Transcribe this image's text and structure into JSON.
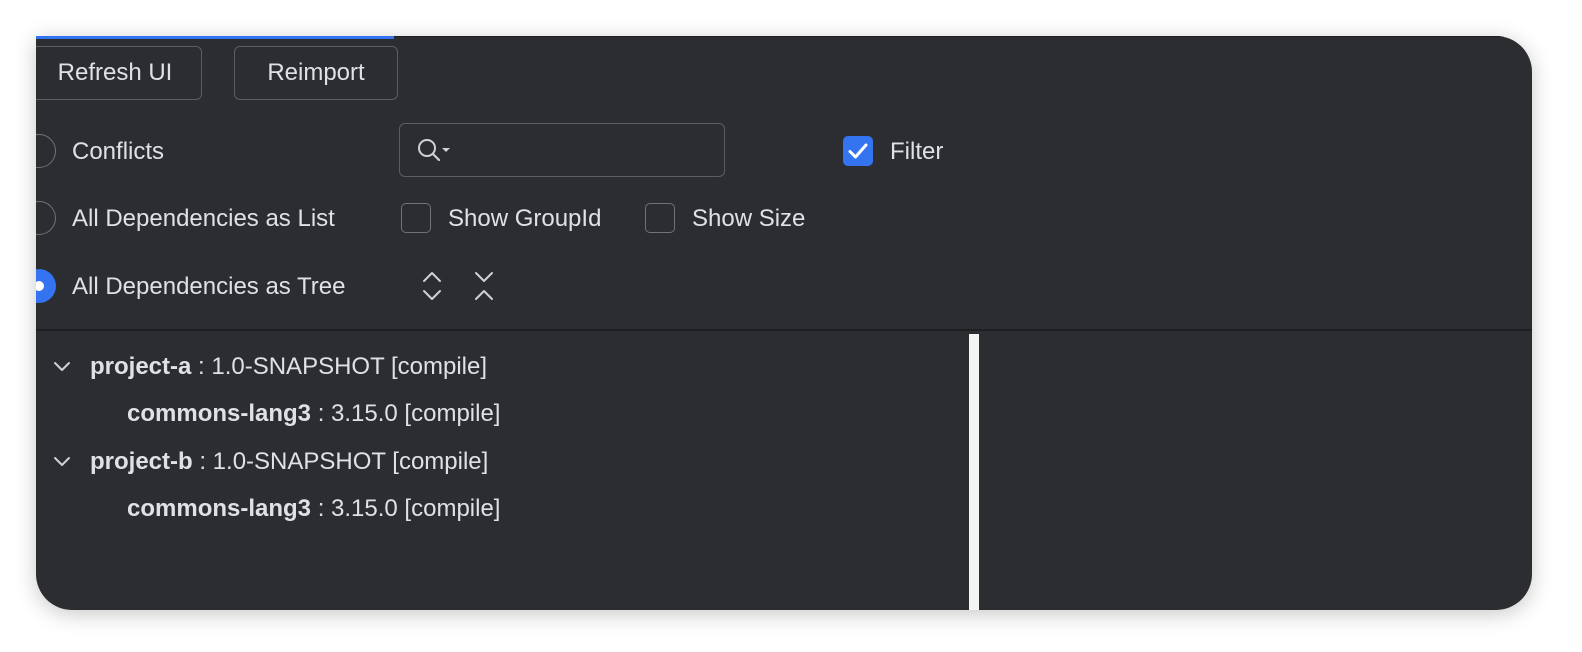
{
  "toolbar": {
    "refresh_label": "Refresh UI",
    "reimport_label": "Reimport"
  },
  "options": {
    "conflicts_label": "Conflicts",
    "list_label": "All Dependencies as List",
    "tree_label": "All Dependencies as Tree",
    "selected_mode": "All Dependencies as Tree",
    "filter_label": "Filter",
    "filter_checked": true,
    "show_groupid_label": "Show GroupId",
    "show_groupid_checked": false,
    "show_size_label": "Show Size",
    "show_size_checked": false
  },
  "search": {
    "value": "",
    "placeholder": ""
  },
  "tree": {
    "nodes": [
      {
        "name": "project-a",
        "detail": " : 1.0-SNAPSHOT [compile]",
        "expanded": true,
        "children": [
          {
            "name": "commons-lang3",
            "detail": " : 3.15.0 [compile]"
          }
        ]
      },
      {
        "name": "project-b",
        "detail": " : 1.0-SNAPSHOT [compile]",
        "expanded": true,
        "children": [
          {
            "name": "commons-lang3",
            "detail": " : 3.15.0 [compile]"
          }
        ]
      }
    ]
  },
  "colors": {
    "background": "#2b2d30",
    "accent": "#3574f0",
    "text": "#dfe1e5"
  },
  "icons": {
    "expand_all": "expand-all-icon",
    "collapse_all": "collapse-all-icon",
    "search": "search-icon",
    "chevron": "chevron-down-icon"
  }
}
